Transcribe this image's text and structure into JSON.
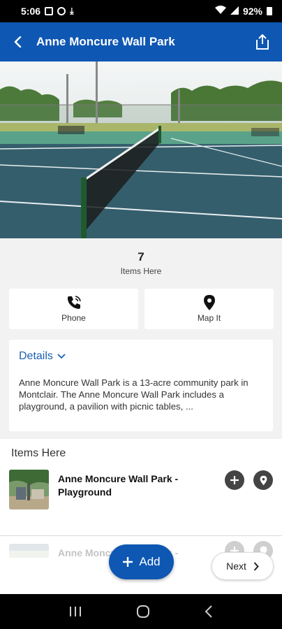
{
  "status_bar": {
    "time": "5:06",
    "battery": "92%"
  },
  "header": {
    "title": "Anne Moncure Wall Park"
  },
  "stats": {
    "count": "7",
    "label": "Items Here"
  },
  "actions": [
    {
      "label": "Phone",
      "icon": "phone-icon"
    },
    {
      "label": "Map It",
      "icon": "map-pin-icon"
    }
  ],
  "details": {
    "label": "Details",
    "text": "Anne Moncure Wall Park is a 13-acre community park in Montclair. The Anne Moncure Wall Park includes a playground, a pavilion with picnic tables, ..."
  },
  "items_section": {
    "title": "Items Here",
    "items": [
      {
        "name": "Anne Moncure Wall Park - Playground"
      },
      {
        "name": "Anne Moncure Wall Park -"
      }
    ]
  },
  "buttons": {
    "add": "Add",
    "next": "Next"
  },
  "colors": {
    "primary": "#0e57b3",
    "link": "#1a5fb4"
  }
}
